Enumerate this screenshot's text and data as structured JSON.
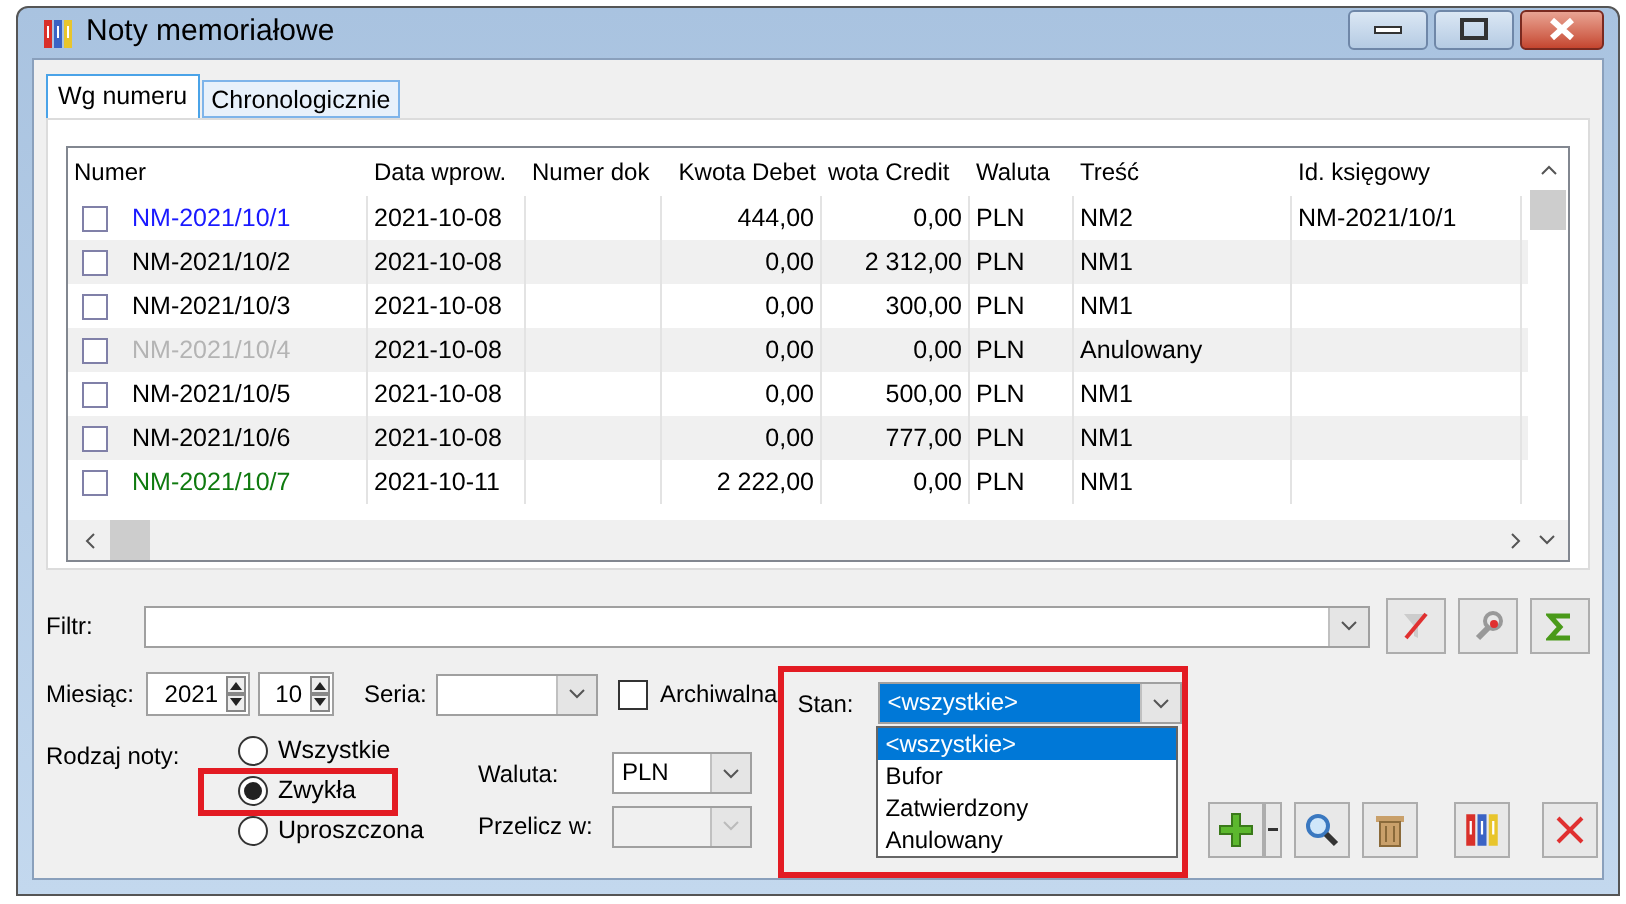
{
  "window": {
    "title": "Noty memoriałowe"
  },
  "tabs": [
    {
      "label": "Wg numeru",
      "selected": true
    },
    {
      "label": "Chronologicznie",
      "selected": false
    }
  ],
  "table": {
    "columns": [
      "Numer",
      "Data wprow.",
      "Numer dok",
      "Kwota Debet",
      "wota Credit",
      "Waluta",
      "Treść",
      "Id. księgowy"
    ],
    "rows": [
      {
        "checked": false,
        "color": "#1a1aff",
        "number": "NM-2021/10/1",
        "date": "2021-10-08",
        "debit": "444,00",
        "credit": "0,00",
        "currency": "PLN",
        "content": "NM2",
        "ledger_id": "NM-2021/10/1"
      },
      {
        "checked": false,
        "color": "#000000",
        "number": "NM-2021/10/2",
        "date": "2021-10-08",
        "debit": "0,00",
        "credit": "2 312,00",
        "currency": "PLN",
        "content": "NM1"
      },
      {
        "checked": false,
        "color": "#000000",
        "number": "NM-2021/10/3",
        "date": "2021-10-08",
        "debit": "0,00",
        "credit": "300,00",
        "currency": "PLN",
        "content": "NM1"
      },
      {
        "checked": false,
        "color": "#b4b4b4",
        "number": "NM-2021/10/4",
        "date": "2021-10-08",
        "debit": "0,00",
        "credit": "0,00",
        "currency": "PLN",
        "content": "Anulowany"
      },
      {
        "checked": false,
        "color": "#000000",
        "number": "NM-2021/10/5",
        "date": "2021-10-08",
        "debit": "0,00",
        "credit": "500,00",
        "currency": "PLN",
        "content": "NM1"
      },
      {
        "checked": false,
        "color": "#000000",
        "number": "NM-2021/10/6",
        "date": "2021-10-08",
        "debit": "0,00",
        "credit": "777,00",
        "currency": "PLN",
        "content": "NM1"
      },
      {
        "checked": false,
        "color": "#0f7a0f",
        "number": "NM-2021/10/7",
        "date": "2021-10-11",
        "debit": "2 222,00",
        "credit": "0,00",
        "currency": "PLN",
        "content": "NM1"
      }
    ]
  },
  "filter": {
    "label": "Filtr:"
  },
  "month": {
    "label": "Miesiąc:",
    "year": "2021",
    "month": "10"
  },
  "series": {
    "label": "Seria:"
  },
  "archive": {
    "label": "Archiwalna",
    "checked": false
  },
  "note_type": {
    "label": "Rodzaj noty:",
    "options": [
      {
        "label": "Wszystkie",
        "selected": false
      },
      {
        "label": "Zwykła",
        "selected": true
      },
      {
        "label": "Uproszczona",
        "selected": false
      }
    ]
  },
  "currency": {
    "label": "Waluta:",
    "value": "PLN"
  },
  "convert": {
    "label": "Przelicz w:",
    "disabled": true
  },
  "state": {
    "label": "Stan:",
    "value": "<wszystkie>",
    "expanded": true,
    "options": [
      {
        "label": "<wszystkie>",
        "selected": true
      },
      {
        "label": "Bufor",
        "selected": false
      },
      {
        "label": "Zatwierdzony",
        "selected": false
      },
      {
        "label": "Anulowany",
        "selected": false
      }
    ]
  }
}
